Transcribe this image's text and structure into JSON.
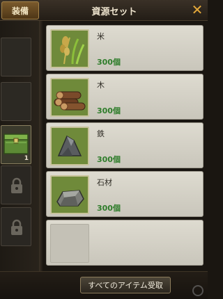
{
  "header": {
    "equip_tab": "装備",
    "title": "資源セット",
    "close_symbol": "✕"
  },
  "left_slots": [
    {
      "state": "empty"
    },
    {
      "state": "empty"
    },
    {
      "state": "item",
      "icon": "green-chest-icon",
      "count": "1"
    },
    {
      "state": "locked",
      "icon": "lock-icon"
    },
    {
      "state": "locked",
      "icon": "lock-icon"
    }
  ],
  "items": [
    {
      "name": "米",
      "qty": "300個",
      "icon": "rice-icon"
    },
    {
      "name": "木",
      "qty": "300個",
      "icon": "wood-log-icon"
    },
    {
      "name": "鉄",
      "qty": "300個",
      "icon": "iron-ore-icon"
    },
    {
      "name": "石材",
      "qty": "300個",
      "icon": "stone-block-icon"
    },
    {
      "name": "",
      "qty": "",
      "icon": ""
    }
  ],
  "footer": {
    "claim_all_label": "すべてのアイテム受取"
  },
  "colors": {
    "qty_green": "#2f7d2b",
    "close_orange": "#e5a93a",
    "panel_bg": "#d8d5ca"
  }
}
